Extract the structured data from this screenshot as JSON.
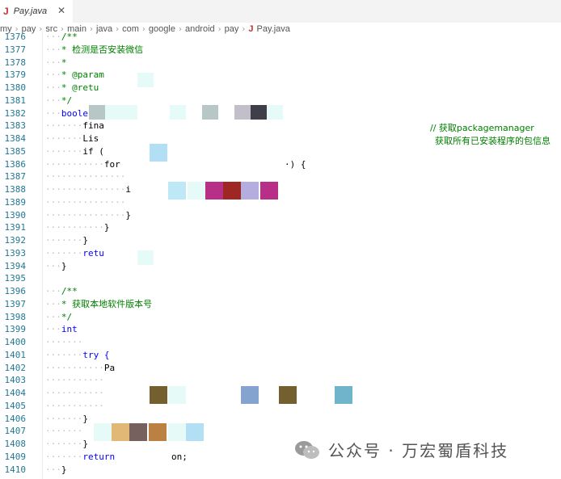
{
  "tab": {
    "icon": "J",
    "label": "Pay.java",
    "close": "✕"
  },
  "breadcrumb": [
    "my",
    "pay",
    "src",
    "main",
    "java",
    "com",
    "google",
    "android",
    "pay"
  ],
  "breadcrumb_file": "Pay.java",
  "breadcrumb_file_icon": "J",
  "lines": [
    {
      "n": "1376",
      "ws": "···",
      "t": "/**",
      "c": "cm"
    },
    {
      "n": "1377",
      "ws": "···",
      "t": "* 检测是否安装微信",
      "c": "cm"
    },
    {
      "n": "1378",
      "ws": "···",
      "t": "*",
      "c": "cm"
    },
    {
      "n": "1379",
      "ws": "···",
      "t": "* @param",
      "c": "cm"
    },
    {
      "n": "1380",
      "ws": "···",
      "t": "* @retu",
      "c": "cm"
    },
    {
      "n": "1381",
      "ws": "···",
      "t": "*/",
      "c": "cm"
    },
    {
      "n": "1382",
      "ws": "···",
      "t": "boole",
      "c": "kw"
    },
    {
      "n": "1383",
      "ws": "·······",
      "t": "fina",
      "c": ""
    },
    {
      "n": "1384",
      "ws": "·······",
      "t": "Lis",
      "c": ""
    },
    {
      "n": "1385",
      "ws": "·······",
      "t": "if (",
      "c": ""
    },
    {
      "n": "1386",
      "ws": "···········",
      "t": "for",
      "c": ""
    },
    {
      "n": "1387",
      "ws": "···············",
      "t": "",
      "c": ""
    },
    {
      "n": "1388",
      "ws": "···············",
      "t": "i",
      "c": ""
    },
    {
      "n": "1389",
      "ws": "···············",
      "t": "",
      "c": ""
    },
    {
      "n": "1390",
      "ws": "···············",
      "t": "}",
      "c": ""
    },
    {
      "n": "1391",
      "ws": "···········",
      "t": "}",
      "c": ""
    },
    {
      "n": "1392",
      "ws": "·······",
      "t": "}",
      "c": ""
    },
    {
      "n": "1393",
      "ws": "·······",
      "t": "retu",
      "c": "kw"
    },
    {
      "n": "1394",
      "ws": "···",
      "t": "}",
      "c": ""
    },
    {
      "n": "1395",
      "ws": "",
      "t": "",
      "c": ""
    },
    {
      "n": "1396",
      "ws": "···",
      "t": "/**",
      "c": "cm"
    },
    {
      "n": "1397",
      "ws": "···",
      "t": "* 获取本地软件版本号",
      "c": "cm"
    },
    {
      "n": "1398",
      "ws": "···",
      "t": "*/",
      "c": "cm"
    },
    {
      "n": "1399",
      "ws": "···",
      "t": "int",
      "c": "kw"
    },
    {
      "n": "1400",
      "ws": "·······",
      "t": "",
      "c": ""
    },
    {
      "n": "1401",
      "ws": "·······",
      "t": "try {",
      "c": "kw"
    },
    {
      "n": "1402",
      "ws": "···········",
      "t": "Pa",
      "c": ""
    },
    {
      "n": "1403",
      "ws": "···········",
      "t": "",
      "c": ""
    },
    {
      "n": "1404",
      "ws": "···········",
      "t": "",
      "c": ""
    },
    {
      "n": "1405",
      "ws": "···········",
      "t": "",
      "c": ""
    },
    {
      "n": "1406",
      "ws": "·······",
      "t": "}",
      "c": ""
    },
    {
      "n": "1407",
      "ws": "·······",
      "t": "",
      "c": ""
    },
    {
      "n": "1408",
      "ws": "·······",
      "t": "}",
      "c": ""
    },
    {
      "n": "1409",
      "ws": "·······",
      "t": "return",
      "c": "kw"
    },
    {
      "n": "1410",
      "ws": "···",
      "t": "}",
      "c": ""
    }
  ],
  "line_1386_tail": "·) {",
  "line_1409_tail": "on;",
  "notes": {
    "packagemanager": "// 获取packagemanager",
    "all_packages": "获取所有已安装程序的包信息"
  },
  "colors": {
    "blur": [
      "#b7c7c6",
      "#c2bfcb",
      "#3f3f49",
      "#b72f86",
      "#9e2724",
      "#b4addd",
      "#74602f",
      "#84a3cf",
      "#70b4cc",
      "#e2b876",
      "#77615f",
      "#bb8142",
      "#b2dff4",
      "#bfe8f7",
      "#e6faf8"
    ]
  },
  "watermark": "公众号 · 万宏蜀盾科技"
}
